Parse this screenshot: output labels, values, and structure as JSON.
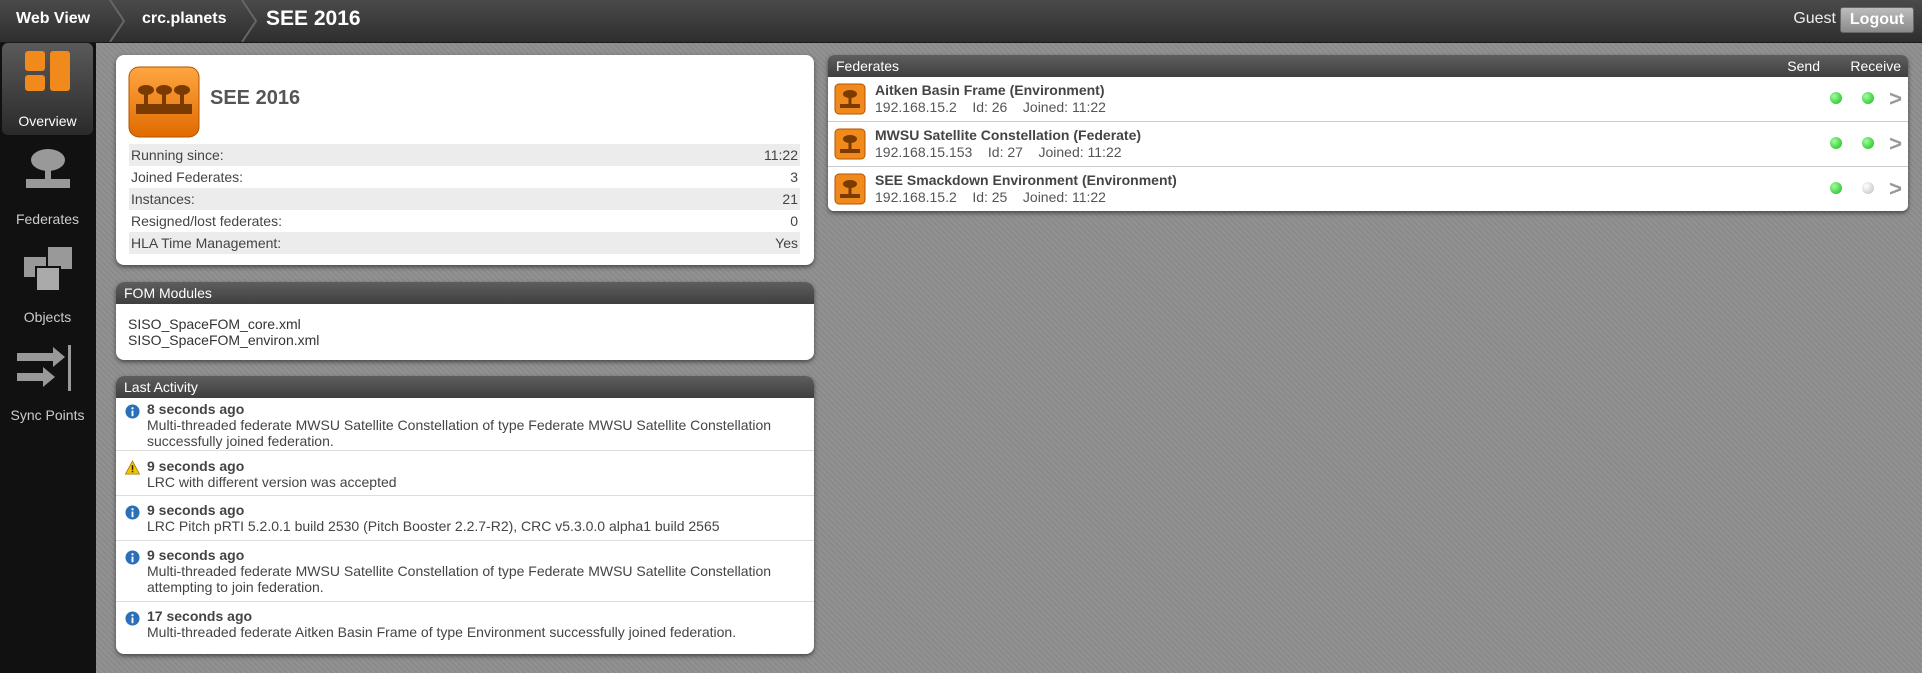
{
  "topbar": {
    "breadcrumbs": [
      "Web View",
      "crc.planets",
      "SEE 2016"
    ],
    "user": "Guest",
    "logout_label": "Logout"
  },
  "sidebar": {
    "items": [
      {
        "label": "Overview",
        "icon": "overview-icon",
        "active": true
      },
      {
        "label": "Federates",
        "icon": "federates-icon",
        "active": false
      },
      {
        "label": "Objects",
        "icon": "objects-icon",
        "active": false
      },
      {
        "label": "Sync Points",
        "icon": "sync-points-icon",
        "active": false
      }
    ]
  },
  "federation": {
    "title": "SEE 2016",
    "stats": [
      {
        "label": "Running since:",
        "value": "11:22"
      },
      {
        "label": "Joined Federates:",
        "value": "3"
      },
      {
        "label": "Instances:",
        "value": "21"
      },
      {
        "label": "Resigned/lost federates:",
        "value": "0"
      },
      {
        "label": "HLA Time Management:",
        "value": "Yes"
      }
    ]
  },
  "fom": {
    "title": "FOM Modules",
    "modules": [
      "SISO_SpaceFOM_core.xml",
      "SISO_SpaceFOM_environ.xml"
    ]
  },
  "activity": {
    "title": "Last Activity",
    "items": [
      {
        "type": "info",
        "time": "8 seconds ago",
        "lines": [
          "Multi-threaded federate MWSU Satellite Constellation of type Federate MWSU Satellite Constellation",
          "successfully joined federation."
        ]
      },
      {
        "type": "warning",
        "time": "9 seconds ago",
        "lines": [
          "LRC with different version was accepted"
        ]
      },
      {
        "type": "info",
        "time": "9 seconds ago",
        "lines": [
          "LRC Pitch pRTI 5.2.0.1 build 2530 (Pitch Booster 2.2.7-R2), CRC v5.3.0.0 alpha1 build 2565"
        ]
      },
      {
        "type": "info",
        "time": "9 seconds ago",
        "lines": [
          "Multi-threaded federate MWSU Satellite Constellation of type Federate MWSU Satellite Constellation",
          "attempting to join federation."
        ]
      },
      {
        "type": "info",
        "time": "17 seconds ago",
        "lines": [
          "Multi-threaded federate Aitken Basin Frame of type Environment successfully joined federation."
        ]
      }
    ]
  },
  "federates": {
    "title": "Federates",
    "send_label": "Send",
    "receive_label": "Receive",
    "items": [
      {
        "name": "Aitken Basin Frame (Environment)",
        "ip": "192.168.15.2",
        "id": "Id: 26",
        "joined": "Joined: 11:22",
        "send": "green",
        "receive": "green"
      },
      {
        "name": "MWSU Satellite Constellation (Federate)",
        "ip": "192.168.15.153",
        "id": "Id: 27",
        "joined": "Joined: 11:22",
        "send": "green",
        "receive": "green"
      },
      {
        "name": "SEE Smackdown Environment (Environment)",
        "ip": "192.168.15.2",
        "id": "Id: 25",
        "joined": "Joined: 11:22",
        "send": "green",
        "receive": "gray"
      }
    ]
  },
  "colors": {
    "orange": "#f08a1c",
    "led_green": "#2ecc2e",
    "led_gray": "#c8c8c8"
  }
}
